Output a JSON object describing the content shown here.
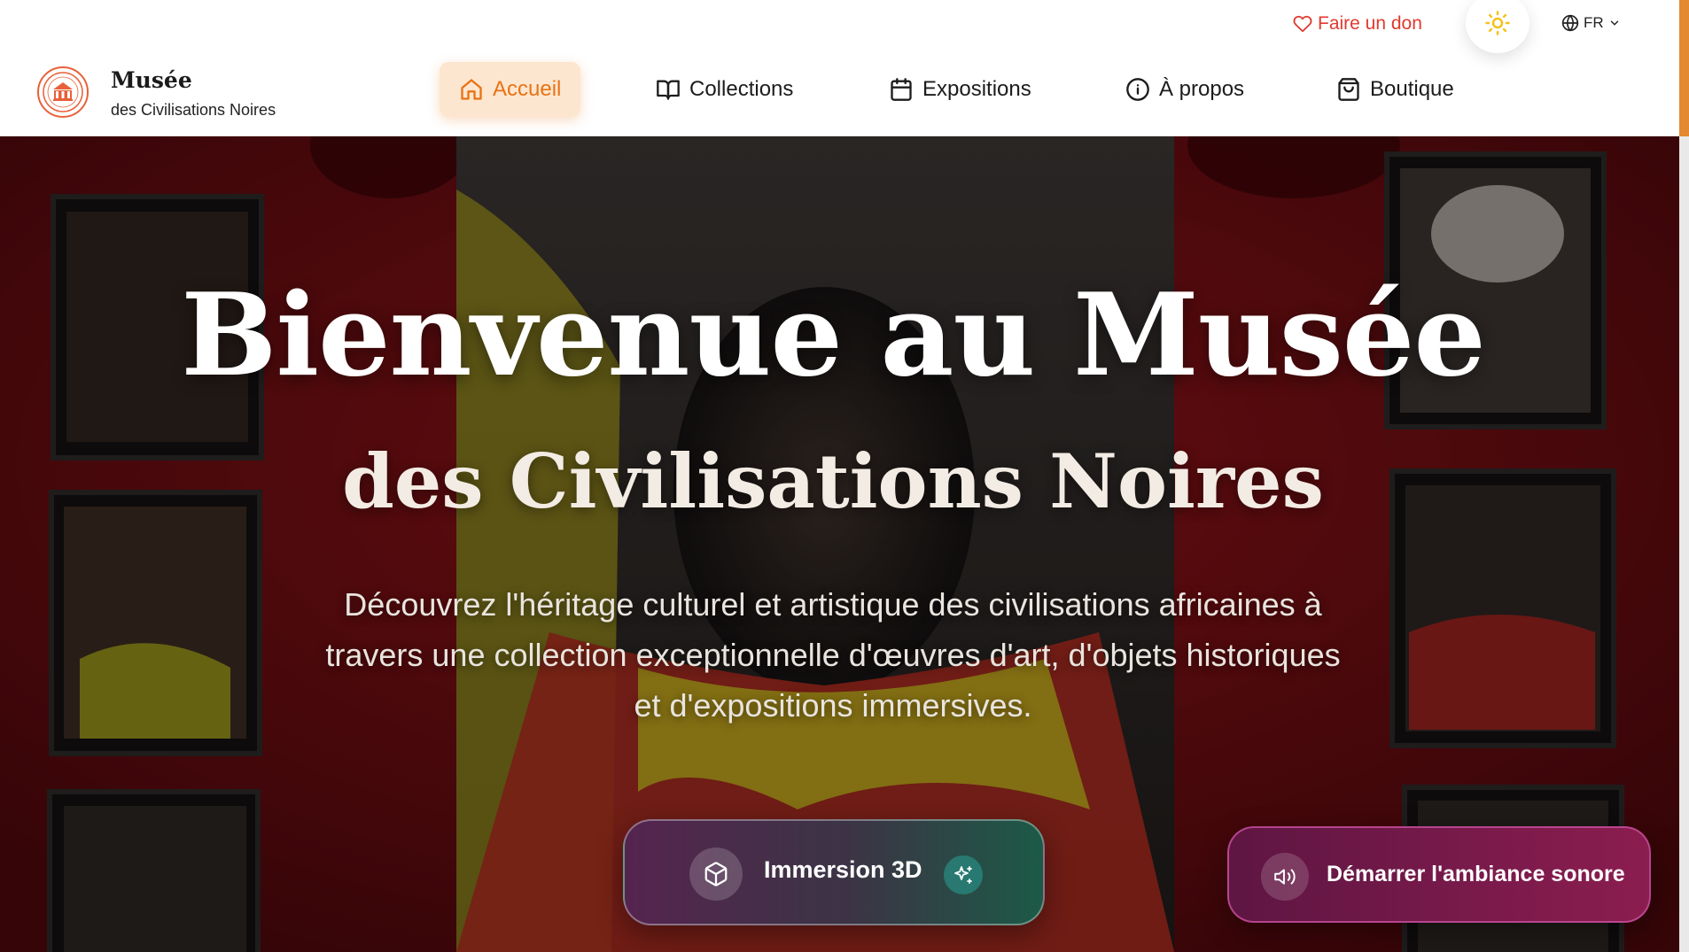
{
  "header": {
    "donate_label": "Faire un don",
    "language": "FR",
    "brand": {
      "title": "Musée",
      "subtitle": "des Civilisations Noires"
    },
    "nav": [
      {
        "label": "Accueil",
        "icon": "home-icon",
        "active": true
      },
      {
        "label": "Collections",
        "icon": "book-open-icon",
        "active": false
      },
      {
        "label": "Expositions",
        "icon": "calendar-icon",
        "active": false
      },
      {
        "label": "À propos",
        "icon": "info-icon",
        "active": false
      },
      {
        "label": "Boutique",
        "icon": "shopping-bag-icon",
        "active": false
      }
    ]
  },
  "hero": {
    "title": "Bienvenue au Musée",
    "subtitle": "des Civilisations Noires",
    "description": "Découvrez l'héritage culturel et artistique des civilisations africaines à travers une collection exceptionnelle d'œuvres d'art, d'objets historiques et d'expositions immersives.",
    "immersion_button": "Immersion 3D",
    "sound_button": "Démarrer l'ambiance sonore"
  },
  "colors": {
    "accent": "#e87315",
    "accent_bg": "#fde6cf",
    "donate": "#e0392e",
    "hero_red": "#6e0d12",
    "theme_sun": "#f4c21a"
  }
}
